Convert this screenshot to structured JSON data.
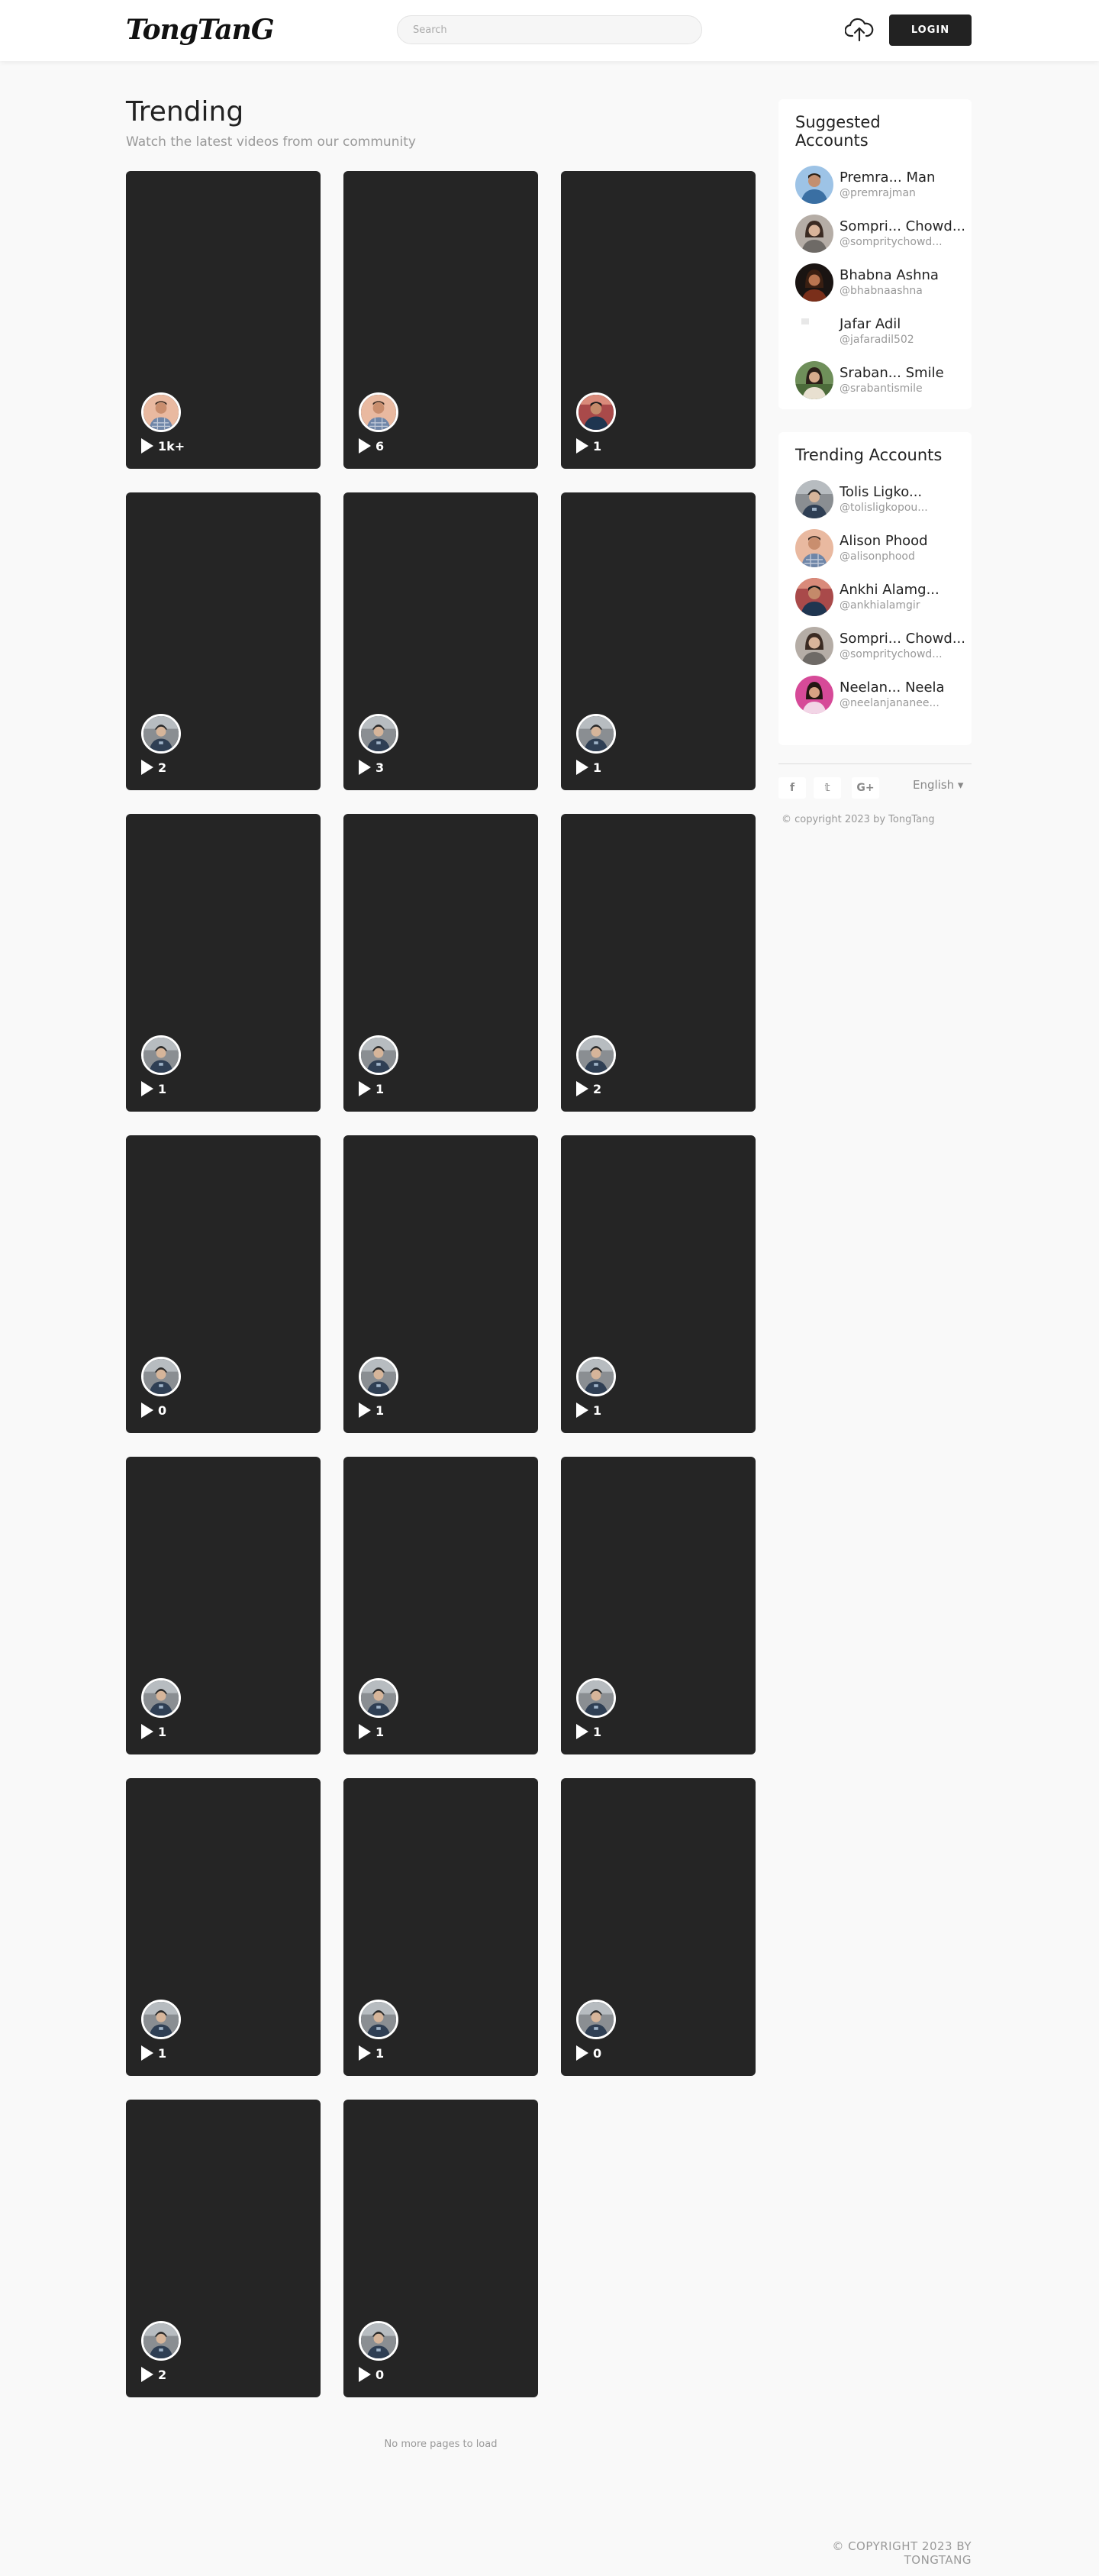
{
  "header": {
    "logo_text": "TongTanG",
    "search_placeholder": "Search",
    "login_label": "LOGIN"
  },
  "main": {
    "title": "Trending",
    "subtitle": "Watch the latest videos from our community",
    "no_more_text": "No more pages to load"
  },
  "videos": [
    {
      "plays": "1k+",
      "avatar": "man-checked-shirt"
    },
    {
      "plays": "6",
      "avatar": "man-checked-shirt"
    },
    {
      "plays": "1",
      "avatar": "man-dark-jacket"
    },
    {
      "plays": "2",
      "avatar": "guy-beanie"
    },
    {
      "plays": "3",
      "avatar": "guy-beanie"
    },
    {
      "plays": "1",
      "avatar": "guy-beanie"
    },
    {
      "plays": "1",
      "avatar": "guy-beanie"
    },
    {
      "plays": "1",
      "avatar": "guy-beanie"
    },
    {
      "plays": "2",
      "avatar": "guy-beanie"
    },
    {
      "plays": "0",
      "avatar": "guy-beanie"
    },
    {
      "plays": "1",
      "avatar": "guy-beanie"
    },
    {
      "plays": "1",
      "avatar": "guy-beanie"
    },
    {
      "plays": "1",
      "avatar": "guy-beanie"
    },
    {
      "plays": "1",
      "avatar": "guy-beanie"
    },
    {
      "plays": "1",
      "avatar": "guy-beanie"
    },
    {
      "plays": "1",
      "avatar": "guy-beanie"
    },
    {
      "plays": "1",
      "avatar": "guy-beanie"
    },
    {
      "plays": "0",
      "avatar": "guy-beanie"
    },
    {
      "plays": "2",
      "avatar": "guy-beanie"
    },
    {
      "plays": "0",
      "avatar": "guy-beanie"
    }
  ],
  "sidebar": {
    "suggested_title": "Suggested Accounts",
    "suggested": [
      {
        "name": "Premra... Man",
        "handle": "@premrajman",
        "avatar": "man-blue"
      },
      {
        "name": "Sompri... Chowd...",
        "handle": "@sompritychowd...",
        "avatar": "woman-grey"
      },
      {
        "name": "Bhabna Ashna",
        "handle": "@bhabnaashna",
        "avatar": "woman-dark"
      },
      {
        "name": "Jafar Adil",
        "handle": "@jafaradil502",
        "avatar": "blank"
      },
      {
        "name": "Sraban... Smile",
        "handle": "@srabantismile",
        "avatar": "woman-green"
      }
    ],
    "trending_title": "Trending Accounts",
    "trending": [
      {
        "name": "Tolis Ligko...",
        "handle": "@tolisligkopou...",
        "avatar": "guy-beanie"
      },
      {
        "name": "Alison Phood",
        "handle": "@alisonphood",
        "avatar": "man-checked-shirt"
      },
      {
        "name": "Ankhi Alamg...",
        "handle": "@ankhialamgir",
        "avatar": "man-dark-jacket"
      },
      {
        "name": "Sompri... Chowd...",
        "handle": "@sompritychowd...",
        "avatar": "woman-grey"
      },
      {
        "name": "Neelan... Neela",
        "handle": "@neelanjananee...",
        "avatar": "woman-pink"
      }
    ],
    "social": [
      {
        "label": "f",
        "icon": "facebook-icon"
      },
      {
        "label": "𝕥",
        "icon": "twitter-icon"
      },
      {
        "label": "G+",
        "icon": "google-plus-icon"
      }
    ],
    "language": "English ▾",
    "copyright": "© copyright 2023 by TongTang"
  },
  "footer": {
    "copyright": "© COPYRIGHT 2023 BY TONGTANG"
  },
  "colors": {
    "card_bg": "#252525",
    "page_bg": "#f9f9f9",
    "button_bg": "#222222"
  }
}
